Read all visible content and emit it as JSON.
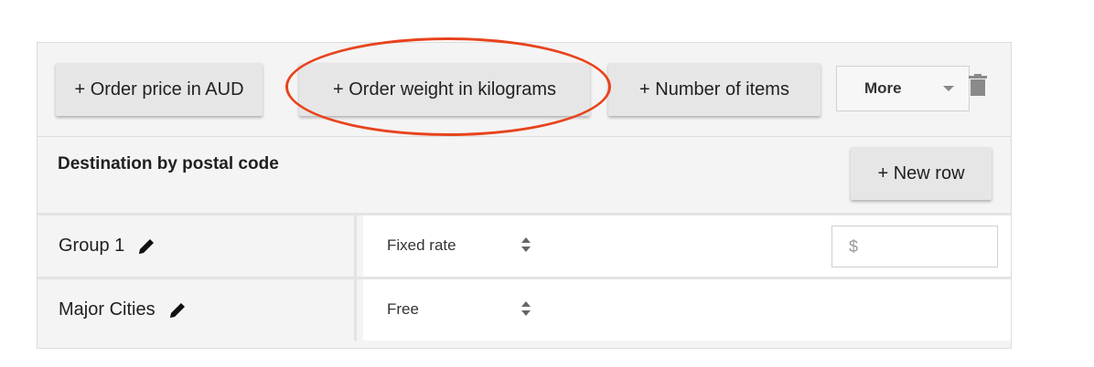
{
  "toolbar": {
    "buttons": [
      {
        "label": "+ Order price in AUD"
      },
      {
        "label": "+ Order weight in kilograms"
      },
      {
        "label": "+ Number of items"
      }
    ],
    "more_label": "More",
    "trash_icon": "trash-icon"
  },
  "section": {
    "title": "Destination by postal code",
    "new_row_label": "+ New row"
  },
  "rows": [
    {
      "name": "Group 1",
      "rate_type": "Fixed rate",
      "price_placeholder": "$"
    },
    {
      "name": "Major Cities",
      "rate_type": "Free"
    }
  ],
  "colors": {
    "annotation": "#e8431c",
    "panel_bg": "#f4f4f4",
    "button_bg": "#e6e6e6"
  }
}
